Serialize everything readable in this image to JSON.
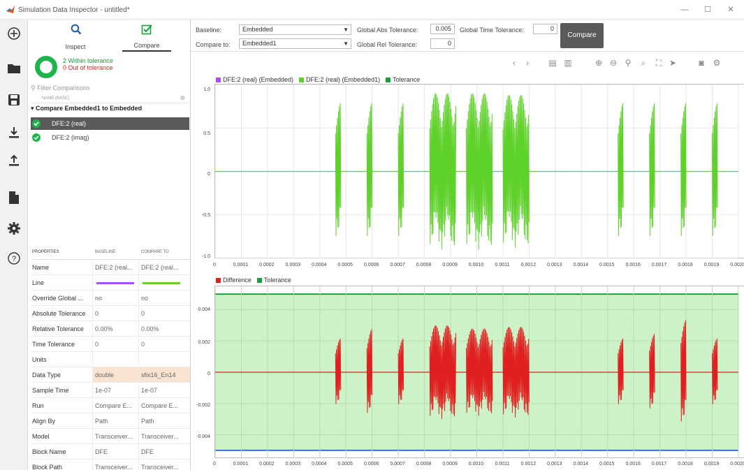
{
  "window": {
    "title": "Simulation Data Inspector - untitled*",
    "min": "—",
    "max": "☐",
    "close": "✕"
  },
  "modes": {
    "inspect": "Inspect",
    "compare": "Compare"
  },
  "summary": {
    "within": "2 Within tolerance",
    "out_of": "0 Out of tolerance"
  },
  "filter_placeholder": "Filter Comparisons",
  "list_header": "NAME (BASE)",
  "group_label": "Compare Embedded1 to Embedded",
  "signals": [
    "DFE:2 (real)",
    "DFE:2 (imag)"
  ],
  "props": {
    "headers": [
      "PROPERTIES",
      "BASELINE",
      "COMPARE TO"
    ],
    "rows": [
      [
        "Name",
        "DFE:2 (real...",
        "DFE:2 (real..."
      ],
      [
        "Line",
        "",
        ""
      ],
      [
        "Override Global ...",
        "no",
        "no"
      ],
      [
        "Absolute Tolerance",
        "0",
        "0"
      ],
      [
        "Relative Tolerance",
        "0.00%",
        "0.00%"
      ],
      [
        "Time Tolerance",
        "0",
        "0"
      ],
      [
        "Units",
        "",
        ""
      ],
      [
        "Data Type",
        "double",
        "sfix16_En14"
      ],
      [
        "Sample Time",
        "1e-07",
        "1e-07"
      ],
      [
        "Run",
        "Compare E...",
        "Compare E..."
      ],
      [
        "Align By",
        "Path",
        "Path"
      ],
      [
        "Model",
        "Transceiver...",
        "Transceiver..."
      ],
      [
        "Block Name",
        "DFE",
        "DFE"
      ],
      [
        "Block Path",
        "Transceiver...",
        "Transceiver..."
      ],
      [
        "Port",
        "2",
        "2"
      ]
    ],
    "baseline_line_color": "#a64dff",
    "compare_line_color": "#5ed12a"
  },
  "toolbar": {
    "baseline_label": "Baseline:",
    "baseline_value": "Embedded",
    "compare_label": "Compare to:",
    "compare_value": "Embedded1",
    "abs_tol_label": "Global Abs Tolerance:",
    "abs_tol_value": "0.005",
    "rel_tol_label": "Global Rel Tolerance:",
    "rel_tol_value": "0",
    "time_tol_label": "Global Time Tolerance:",
    "time_tol_value": "0",
    "compare_button": "Compare"
  },
  "top_plot": {
    "legend": [
      {
        "label": "DFE:2 (real) (Embedded)",
        "color": "#a64dff"
      },
      {
        "label": "DFE:2 (real) (Embedded1)",
        "color": "#5ed12a"
      },
      {
        "label": "Tolerance",
        "color": "#1a9d3c"
      }
    ],
    "yticks": [
      "1.0",
      "0.5",
      "0",
      "-0.5",
      "-1.0"
    ]
  },
  "bottom_plot": {
    "legend": [
      {
        "label": "Difference",
        "color": "#e02020"
      },
      {
        "label": "Tolerance",
        "color": "#1a9d3c"
      }
    ],
    "yticks": [
      "0.004",
      "0.002",
      "0",
      "-0.002",
      "-0.004"
    ]
  },
  "xticks": [
    "0",
    "0.0001",
    "0.0002",
    "0.0003",
    "0.0004",
    "0.0005",
    "0.0006",
    "0.0007",
    "0.0008",
    "0.0009",
    "0.0010",
    "0.0011",
    "0.0012",
    "0.0013",
    "0.0014",
    "0.0015",
    "0.0016",
    "0.0017",
    "0.0018",
    "0.0019",
    "0.0020"
  ],
  "chart_data": [
    {
      "type": "line",
      "x_range": [
        0,
        0.002
      ],
      "ylim": [
        -1.0,
        1.0
      ],
      "bursts": [
        {
          "x": 0.00047,
          "w": 2e-05,
          "amp": 0.8
        },
        {
          "x": 0.00059,
          "w": 2e-05,
          "amp": 0.8
        },
        {
          "x": 0.00071,
          "w": 2e-05,
          "amp": 0.8
        },
        {
          "x": 0.00087,
          "w": 0.0001,
          "amp": 0.9
        },
        {
          "x": 0.00101,
          "w": 0.0001,
          "amp": 0.9
        },
        {
          "x": 0.00115,
          "w": 0.0001,
          "amp": 0.88
        },
        {
          "x": 0.00155,
          "w": 2e-05,
          "amp": 0.8
        },
        {
          "x": 0.00167,
          "w": 2e-05,
          "amp": 0.8
        },
        {
          "x": 0.00179,
          "w": 2e-05,
          "amp": 0.8
        },
        {
          "x": 0.00191,
          "w": 2e-05,
          "amp": 0.8
        }
      ]
    },
    {
      "type": "line",
      "x_range": [
        0,
        0.002
      ],
      "ylim": [
        -0.0055,
        0.0055
      ],
      "tolerance": 0.005,
      "bursts": [
        {
          "x": 0.00047,
          "w": 2e-05,
          "amp": 0.0022
        },
        {
          "x": 0.00059,
          "w": 2e-05,
          "amp": 0.0028
        },
        {
          "x": 0.00071,
          "w": 2e-05,
          "amp": 0.0022
        },
        {
          "x": 0.00087,
          "w": 0.0001,
          "amp": 0.003
        },
        {
          "x": 0.00101,
          "w": 0.0001,
          "amp": 0.0028
        },
        {
          "x": 0.00115,
          "w": 0.0001,
          "amp": 0.0029
        },
        {
          "x": 0.00155,
          "w": 2e-05,
          "amp": 0.0022
        },
        {
          "x": 0.00167,
          "w": 2e-05,
          "amp": 0.0025
        },
        {
          "x": 0.00179,
          "w": 2e-05,
          "amp": 0.0034
        },
        {
          "x": 0.00191,
          "w": 2e-05,
          "amp": 0.0022
        }
      ]
    }
  ]
}
